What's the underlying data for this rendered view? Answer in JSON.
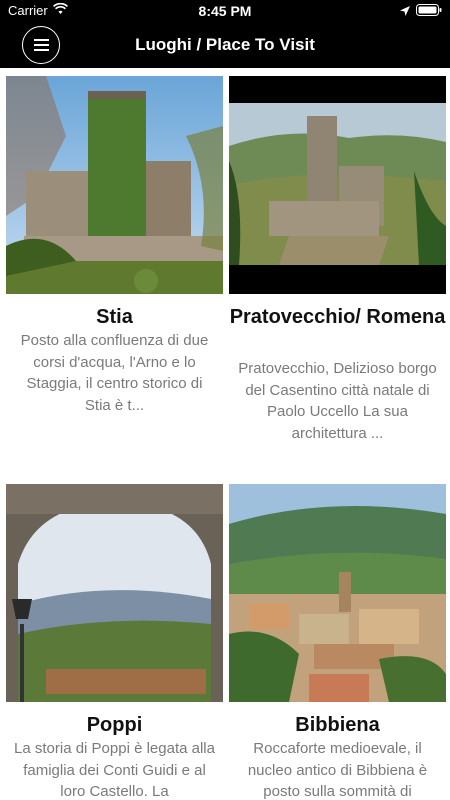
{
  "status_bar": {
    "carrier": "Carrier",
    "time": "8:45 PM"
  },
  "header": {
    "title": "Luoghi / Place To Visit"
  },
  "places": [
    {
      "title": "Stia",
      "description": "Posto alla confluenza di due corsi d'acqua, l'Arno e lo Staggia, il centro storico di Stia è t..."
    },
    {
      "title": "Pratovecchio/ Romena",
      "description": "Pratovecchio, Delizioso borgo del Casentino città natale di Paolo Uccello La sua architettura ..."
    },
    {
      "title": "Poppi",
      "description": "La storia di Poppi è legata alla famiglia dei Conti Guidi e al loro Castello. La"
    },
    {
      "title": "Bibbiena",
      "description": "Roccaforte medioevale, il nucleo antico di Bibbiena è posto sulla sommità di"
    }
  ]
}
